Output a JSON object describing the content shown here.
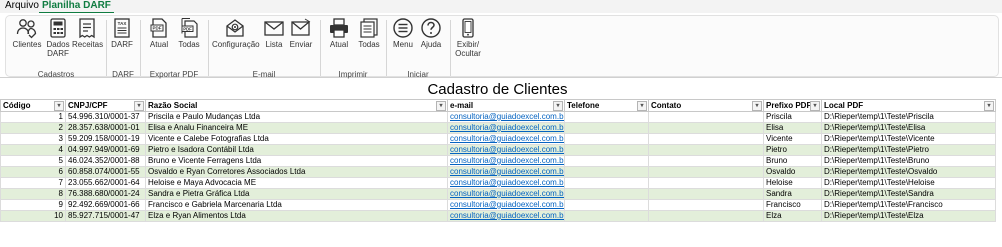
{
  "tabs": [
    "Arquivo",
    "Planilha DARF"
  ],
  "ribbon": {
    "buttons": {
      "clientes": "Clientes",
      "dados_darf_1": "Dados",
      "dados_darf_2": "DARF",
      "receitas": "Receitas",
      "darf": "DARF",
      "atual_pdf": "Atual",
      "todas_pdf": "Todas",
      "configuracao": "Configuração",
      "lista": "Lista",
      "enviar": "Enviar",
      "atual_print": "Atual",
      "todas_print": "Todas",
      "menu": "Menu",
      "ajuda": "Ajuda",
      "exibir_1": "Exibir/",
      "exibir_2": "Ocultar"
    },
    "groups": {
      "cadastros": "Cadastros",
      "darf": "DARF",
      "exportar_pdf": "Exportar PDF",
      "email": "E-mail",
      "imprimir": "Imprimir",
      "iniciar": "Iniciar"
    }
  },
  "sheet": {
    "title": "Cadastro de Clientes",
    "columns": [
      "Código",
      "CNPJ/CPF",
      "Razão Social",
      "e-mail",
      "Telefone",
      "Contato",
      "Prefixo PDF",
      "Local PDF"
    ],
    "rows": [
      [
        "1",
        "54.996.310/0001-37",
        "Priscila e Paulo Mudanças Ltda",
        "consultoria@guiadoexcel.com.br",
        "",
        "",
        "Priscila",
        "D:\\Rieper\\temp\\1\\Teste\\Priscila"
      ],
      [
        "2",
        "28.357.638/0001-01",
        "Elisa e Analu Financeira ME",
        "consultoria@guiadoexcel.com.br",
        "",
        "",
        "Elisa",
        "D:\\Rieper\\temp\\1\\Teste\\Elisa"
      ],
      [
        "3",
        "59.209.158/0001-19",
        "Vicente e Calebe Fotografias Ltda",
        "consultoria@guiadoexcel.com.br",
        "",
        "",
        "Vicente",
        "D:\\Rieper\\temp\\1\\Teste\\Vicente"
      ],
      [
        "4",
        "04.997.949/0001-69",
        "Pietro e Isadora Contábil Ltda",
        "consultoria@guiadoexcel.com.br",
        "",
        "",
        "Pietro",
        "D:\\Rieper\\temp\\1\\Teste\\Pietro"
      ],
      [
        "5",
        "46.024.352/0001-88",
        "Bruno e Vicente Ferragens Ltda",
        "consultoria@guiadoexcel.com.br",
        "",
        "",
        "Bruno",
        "D:\\Rieper\\temp\\1\\Teste\\Bruno"
      ],
      [
        "6",
        "60.858.074/0001-55",
        "Osvaldo e Ryan Corretores Associados Ltda",
        "consultoria@guiadoexcel.com.br",
        "",
        "",
        "Osvaldo",
        "D:\\Rieper\\temp\\1\\Teste\\Osvaldo"
      ],
      [
        "7",
        "23.055.662/0001-64",
        "Heloise e Maya Advocacia ME",
        "consultoria@guiadoexcel.com.br",
        "",
        "",
        "Heloise",
        "D:\\Rieper\\temp\\1\\Teste\\Heloise"
      ],
      [
        "8",
        "76.388.680/0001-24",
        "Sandra e Pietra Gráfica Ltda",
        "consultoria@guiadoexcel.com.br",
        "",
        "",
        "Sandra",
        "D:\\Rieper\\temp\\1\\Teste\\Sandra"
      ],
      [
        "9",
        "92.492.669/0001-66",
        "Francisco e Gabriela Marcenaria Ltda",
        "consultoria@guiadoexcel.com.br",
        "",
        "",
        "Francisco",
        "D:\\Rieper\\temp\\1\\Teste\\Francisco"
      ],
      [
        "10",
        "85.927.715/0001-47",
        "Elza e Ryan Alimentos Ltda",
        "consultoria@guiadoexcel.com.br",
        "",
        "",
        "Elza",
        "D:\\Rieper\\temp\\1\\Teste\\Elza"
      ]
    ]
  },
  "colors": {
    "accent": "#107c41",
    "band": "#e3efda",
    "link": "#0563c1"
  }
}
